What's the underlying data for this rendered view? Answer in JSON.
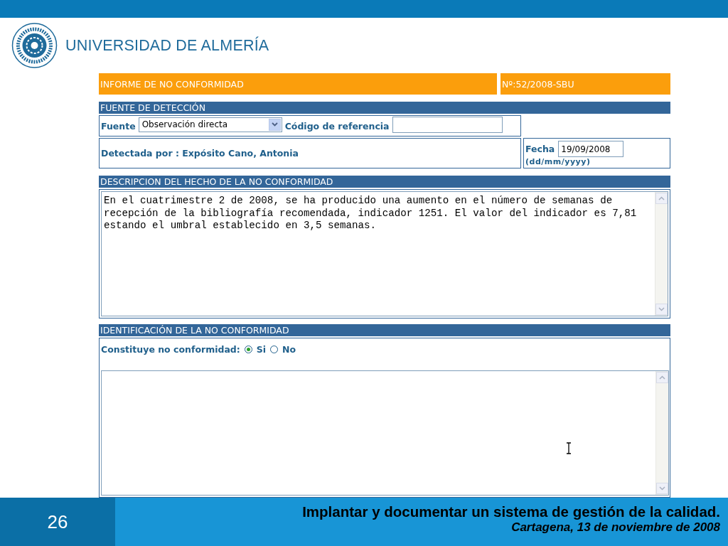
{
  "header": {
    "university_name": "UNIVERSIDAD DE ALMERÍA"
  },
  "form": {
    "title": "INFORME DE NO CONFORMIDAD",
    "number": "Nº:52/2008-SBU",
    "detection": {
      "heading": "FUENTE DE DETECCIÓN",
      "source_label": "Fuente",
      "source_value": "Observación directa",
      "reference_label": "Código de referencia",
      "detected_by": "Detectada por : Expósito Cano, Antonia",
      "date_label": "Fecha",
      "date_value": "19/09/2008",
      "date_format": "(dd/mm/yyyy)"
    },
    "description": {
      "heading": "DESCRIPCION DEL HECHO DE LA NO CONFORMIDAD",
      "text": "En el cuatrimestre 2 de 2008, se ha producido una aumento en el número de semanas de recepción de la bibliografía recomendada, indicador 1251. El valor del indicador es 7,81 estando el umbral establecido en 3,5 semanas."
    },
    "identification": {
      "heading": "IDENTIFICACIÓN DE LA NO CONFORMIDAD",
      "question": "Constituye no conformidad:",
      "options": [
        {
          "label": "Si",
          "selected": true
        },
        {
          "label": "No",
          "selected": false
        }
      ]
    }
  },
  "footer": {
    "page_number": "26",
    "title": "Implantar y documentar un sistema de gestión de la calidad.",
    "subtitle": "Cartagena, 13 de noviembre de 2008"
  }
}
